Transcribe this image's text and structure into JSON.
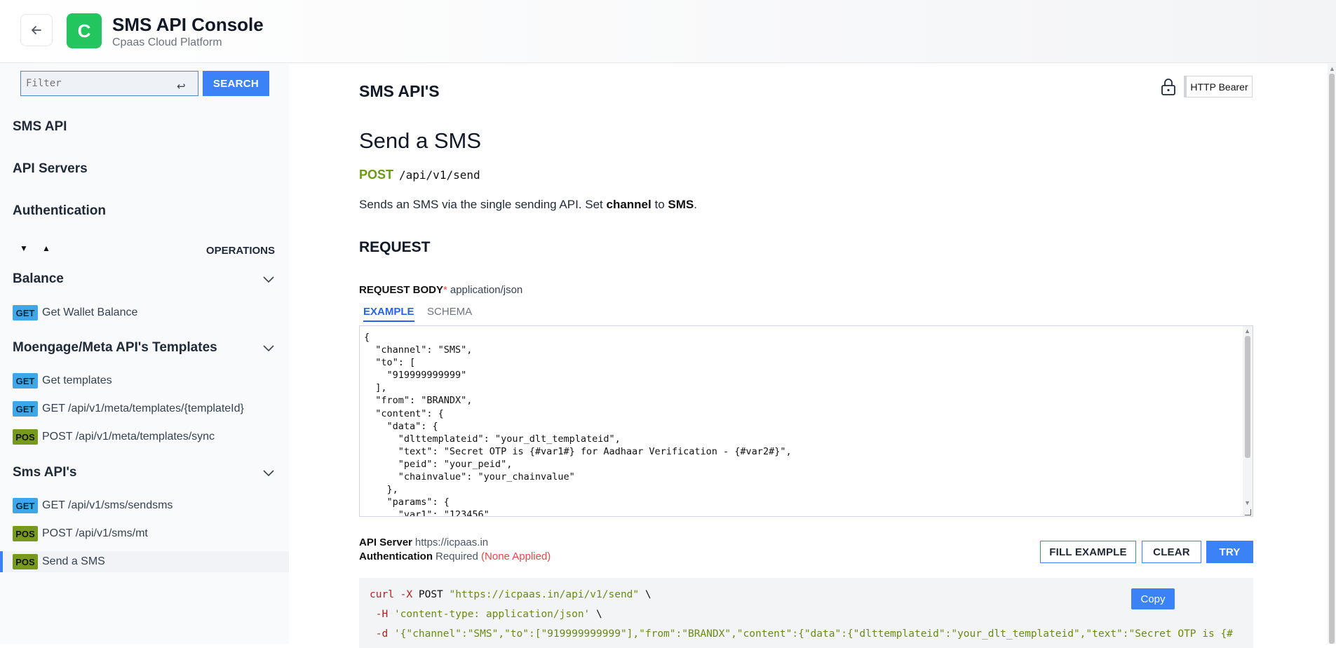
{
  "header": {
    "logo_letter": "C",
    "title": "SMS API Console",
    "subtitle": "Cpaas Cloud Platform"
  },
  "sidebar": {
    "filter_placeholder": "Filter",
    "search_label": "SEARCH",
    "top_links": [
      "SMS API",
      "API Servers",
      "Authentication"
    ],
    "operations_label": "OPERATIONS",
    "groups": [
      {
        "title": "Balance",
        "ops": [
          {
            "method": "GET",
            "label": "Get Wallet Balance"
          }
        ]
      },
      {
        "title": "Moengage/Meta API's Templates",
        "ops": [
          {
            "method": "GET",
            "label": "Get templates"
          },
          {
            "method": "GET",
            "label": "GET /api/v1/meta/templates/{templateId}"
          },
          {
            "method": "POS",
            "label": "POST /api/v1/meta/templates/sync"
          }
        ]
      },
      {
        "title": "Sms API's",
        "ops": [
          {
            "method": "GET",
            "label": "GET /api/v1/sms/sendsms"
          },
          {
            "method": "POS",
            "label": "POST /api/v1/sms/mt"
          },
          {
            "method": "POS",
            "label": "Send a SMS",
            "active": true
          }
        ]
      }
    ]
  },
  "main": {
    "section_title": "SMS API'S",
    "auth_chip": "HTTP Bearer",
    "op_title": "Send a SMS",
    "method": "POST",
    "path": "/api/v1/send",
    "desc": {
      "pre": "Sends an SMS via the single sending API. Set ",
      "b1": "channel",
      "mid": " to ",
      "b2": "SMS",
      "post": "."
    },
    "request_title": "REQUEST",
    "request_body_label": "REQUEST BODY",
    "request_body_required": "*",
    "request_body_type": "application/json",
    "tabs": [
      "EXAMPLE",
      "SCHEMA"
    ],
    "example_body": "{\n  \"channel\": \"SMS\",\n  \"to\": [\n    \"919999999999\"\n  ],\n  \"from\": \"BRANDX\",\n  \"content\": {\n    \"data\": {\n      \"dlttemplateid\": \"your_dlt_templateid\",\n      \"text\": \"Secret OTP is {#var1#} for Aadhaar Verification - {#var2#}\",\n      \"peid\": \"your_peid\",\n      \"chainvalue\": \"your_chainvalue\"\n    },\n    \"params\": {\n      \"var1\": \"123456\",",
    "api_server_label": "API Server",
    "api_server_value": "https://icpaas.in",
    "auth_label": "Authentication",
    "auth_value": "Required",
    "auth_warn": "(None Applied)",
    "buttons": {
      "fill": "FILL EXAMPLE",
      "clear": "CLEAR",
      "try": "TRY"
    },
    "curl": {
      "cmd": "curl",
      "flag_x": "-X",
      "method": "POST",
      "url": "\"https://icpaas.in/api/v1/send\"",
      "cont": "\\",
      "flag_h": "-H",
      "header": "'content-type: application/json'",
      "flag_d": "-d",
      "data": "'{\"channel\":\"SMS\",\"to\":[\"919999999999\"],\"from\":\"BRANDX\",\"content\":{\"data\":{\"dlttemplateid\":\"your_dlt_templateid\",\"text\":\"Secret OTP is {#"
    },
    "copy_label": "Copy"
  }
}
